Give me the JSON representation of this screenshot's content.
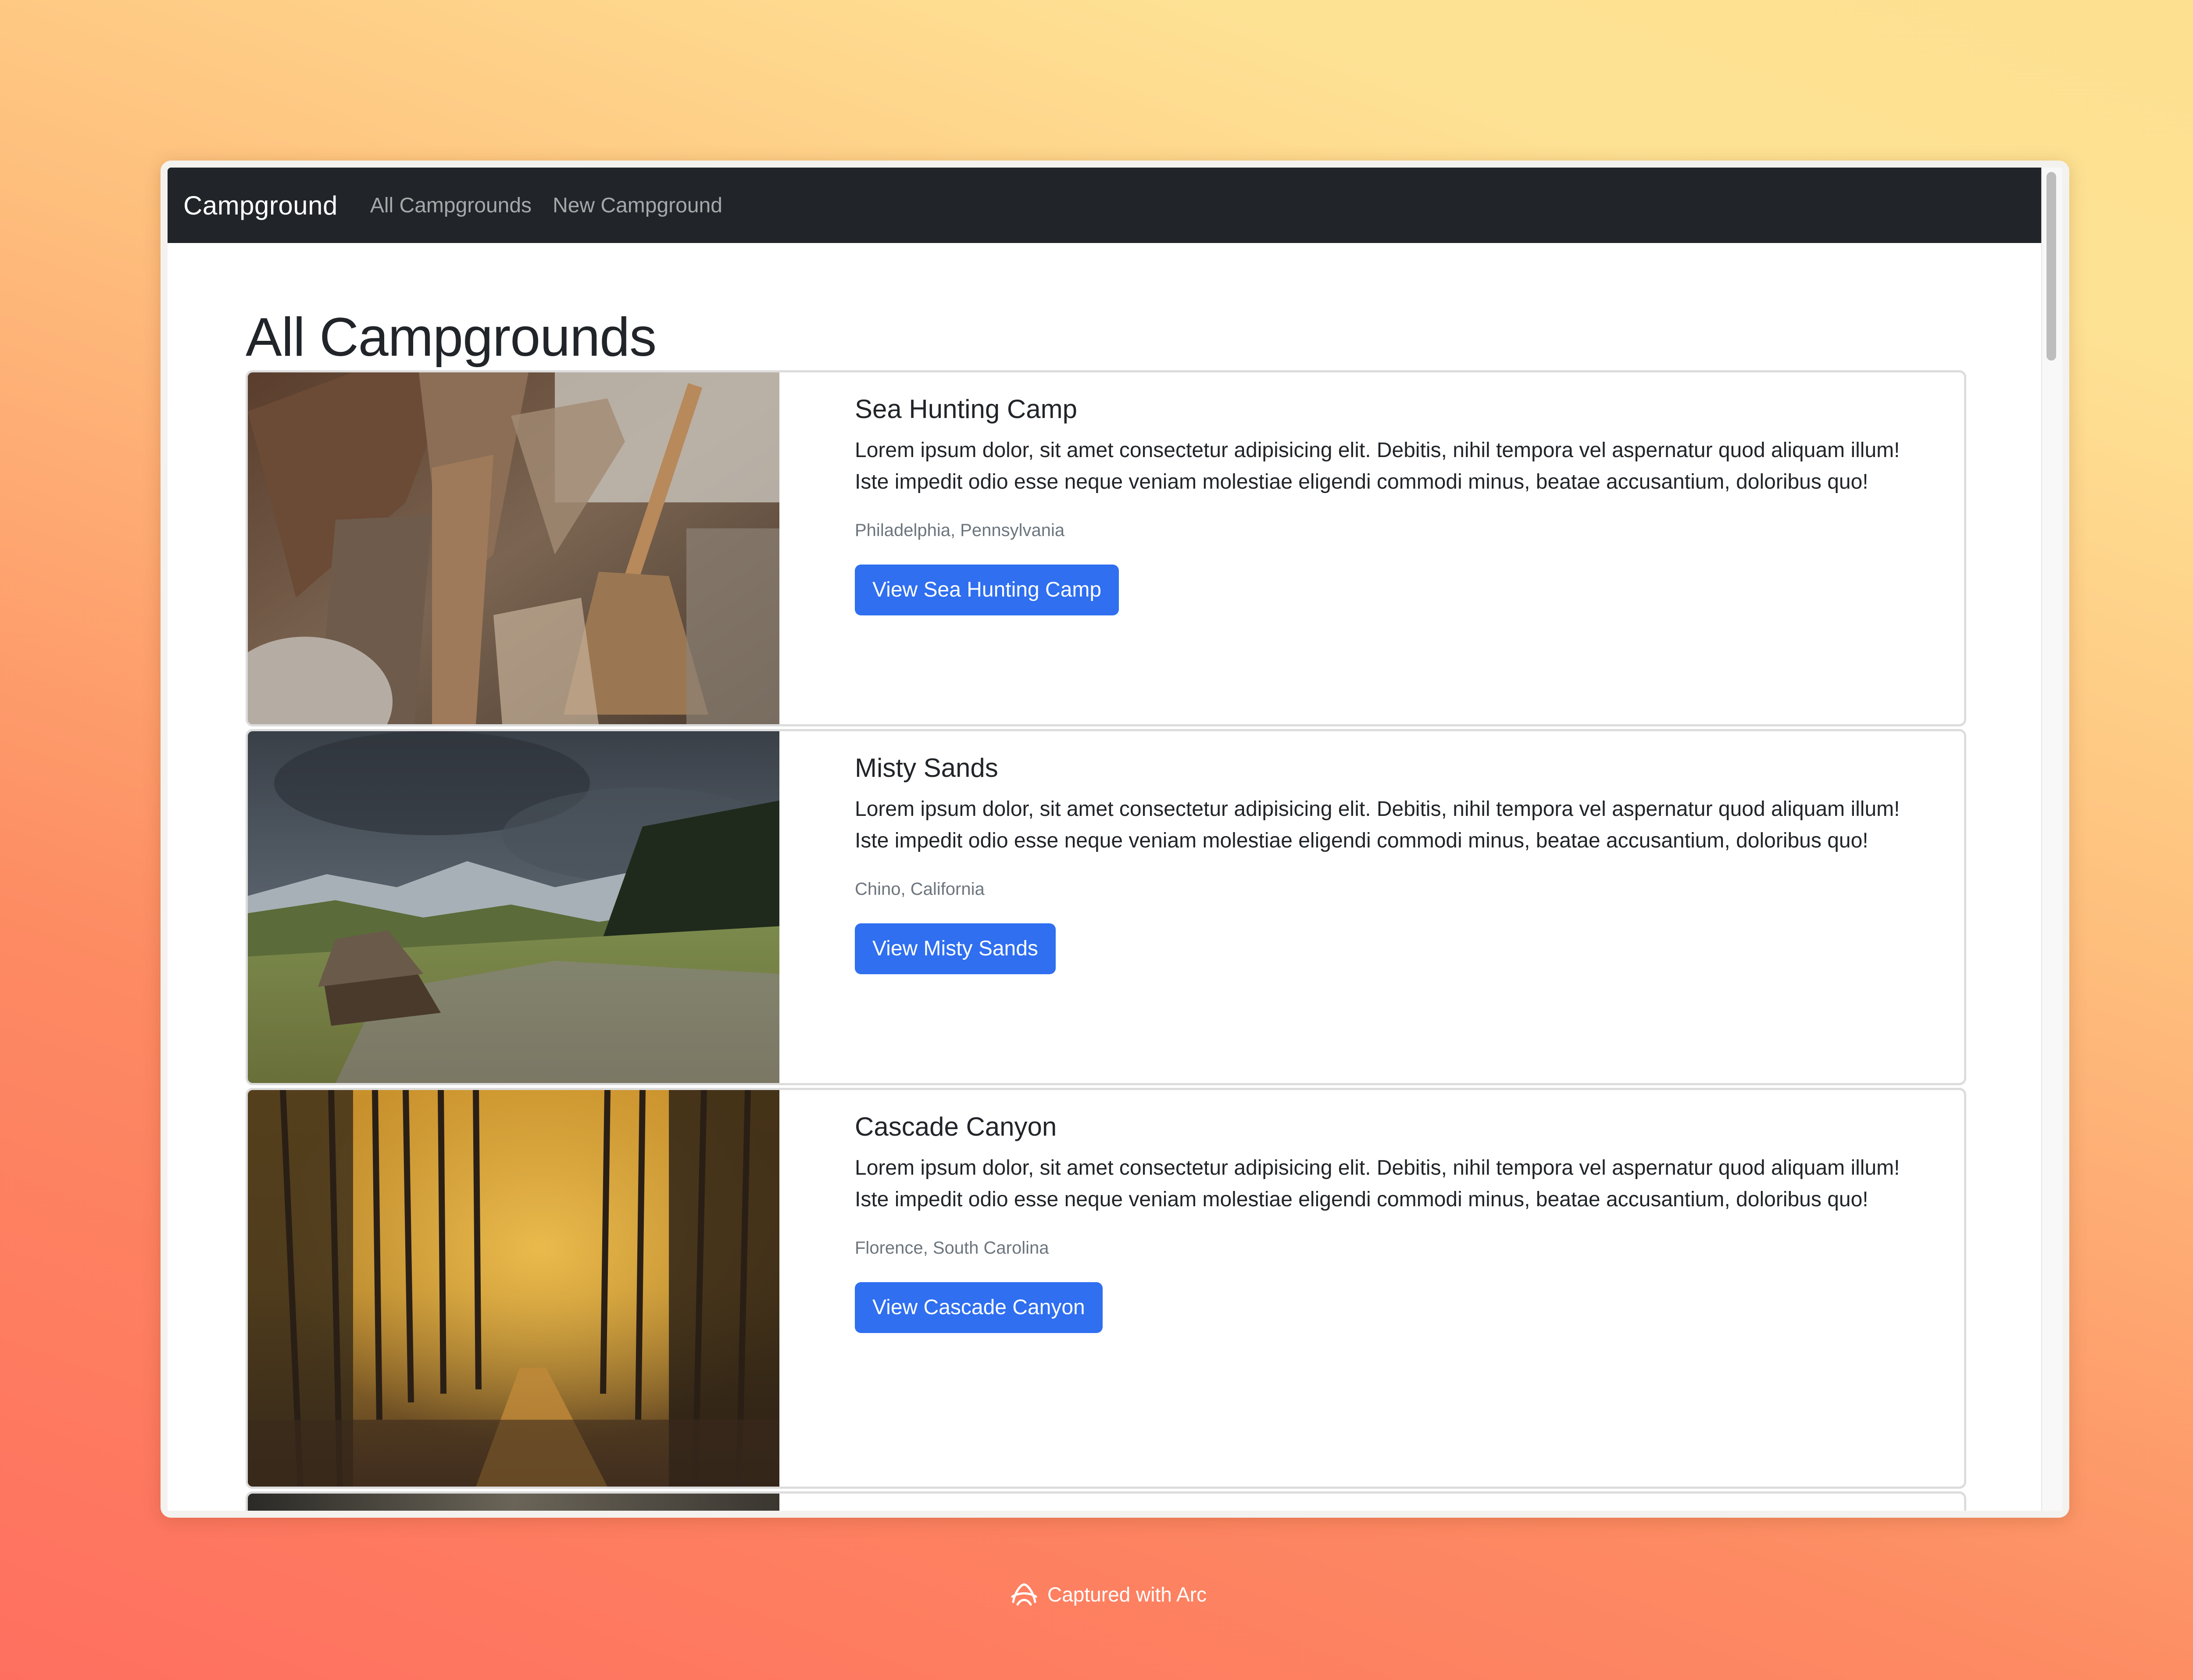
{
  "navbar": {
    "brand": "Campground",
    "links": [
      "All Campgrounds",
      "New Campground"
    ]
  },
  "page": {
    "title": "All Campgrounds"
  },
  "campgrounds": [
    {
      "title": "Sea Hunting Camp",
      "description": "Lorem ipsum dolor, sit amet consectetur adipisicing elit. Debitis, nihil tempora vel aspernatur quod aliquam illum! Iste impedit odio esse neque veniam molestiae eligendi commodi minus, beatae accusantium, doloribus quo!",
      "location": "Philadelphia, Pennsylvania",
      "button": "View Sea Hunting Camp",
      "image": "firewood-and-broom-photo"
    },
    {
      "title": "Misty Sands",
      "description": "Lorem ipsum dolor, sit amet consectetur adipisicing elit. Debitis, nihil tempora vel aspernatur quod aliquam illum! Iste impedit odio esse neque veniam molestiae eligendi commodi minus, beatae accusantium, doloribus quo!",
      "location": "Chino, California",
      "button": "View Misty Sands",
      "image": "mountain-cabin-meadow-photo"
    },
    {
      "title": "Cascade Canyon",
      "description": "Lorem ipsum dolor, sit amet consectetur adipisicing elit. Debitis, nihil tempora vel aspernatur quod aliquam illum! Iste impedit odio esse neque veniam molestiae eligendi commodi minus, beatae accusantium, doloribus quo!",
      "location": "Florence, South Carolina",
      "button": "View Cascade Canyon",
      "image": "autumn-forest-path-photo"
    }
  ],
  "footer": {
    "caption": "Captured with Arc",
    "icon": "arc-logo-icon"
  },
  "colors": {
    "navbar": "#212529",
    "button": "#2f6ff0",
    "muted_text": "#6c757d"
  }
}
